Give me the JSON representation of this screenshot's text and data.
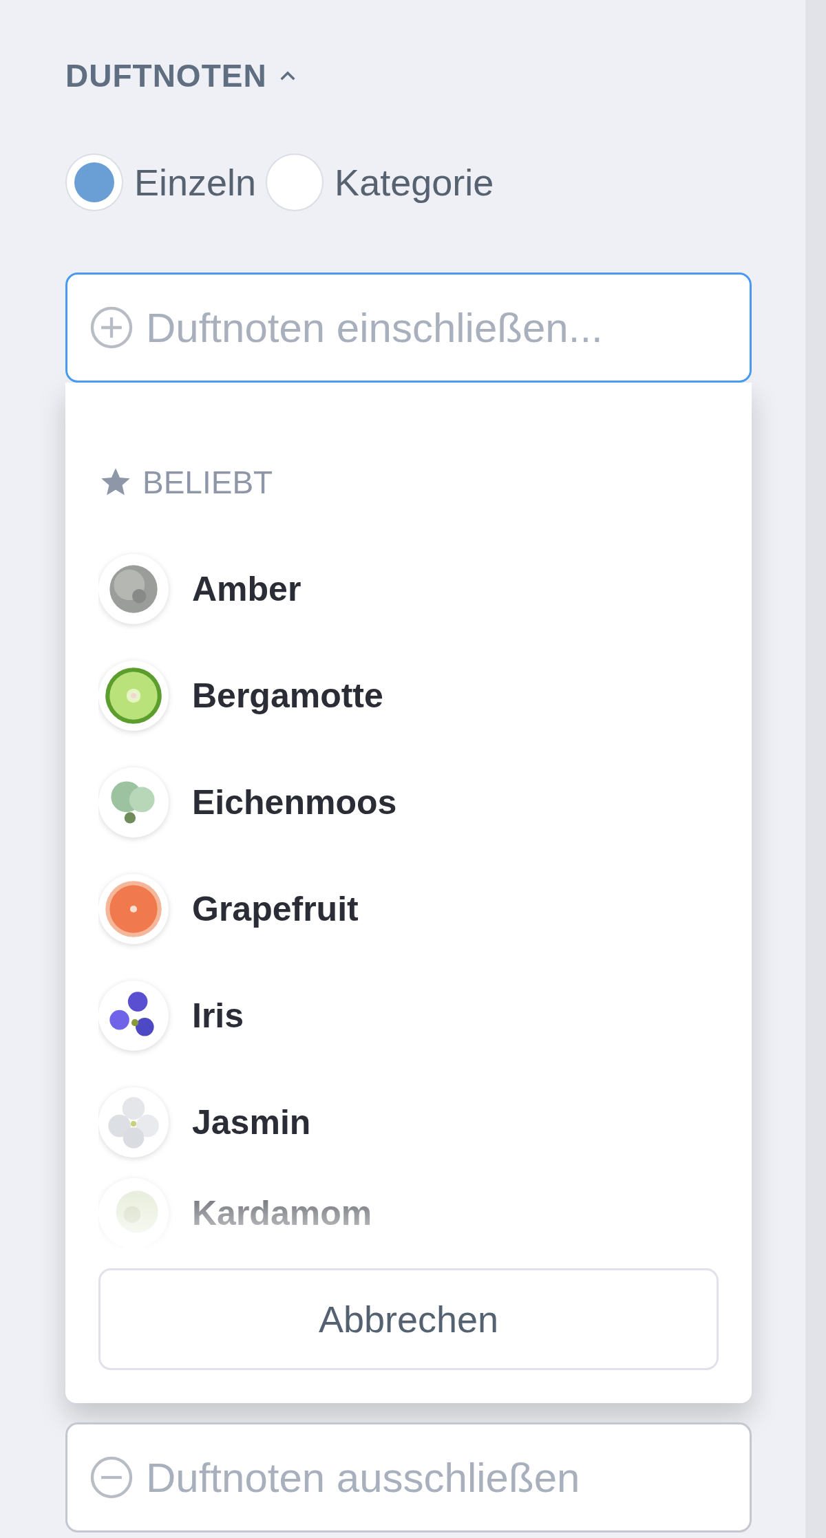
{
  "section": {
    "title": "DUFTNOTEN",
    "expanded": true
  },
  "mode_options": [
    {
      "label": "Einzeln",
      "selected": true
    },
    {
      "label": "Kategorie",
      "selected": false
    }
  ],
  "include_field": {
    "placeholder": "Duftnoten einschließen...",
    "focused": true
  },
  "dropdown": {
    "group_title": "BELIEBT",
    "items": [
      {
        "label": "Amber"
      },
      {
        "label": "Bergamotte"
      },
      {
        "label": "Eichenmoos"
      },
      {
        "label": "Grapefruit"
      },
      {
        "label": "Iris"
      },
      {
        "label": "Jasmin"
      },
      {
        "label": "Kardamom"
      }
    ],
    "cancel_button": "Abbrechen"
  },
  "exclude_field": {
    "placeholder": "Duftnoten ausschließen"
  }
}
